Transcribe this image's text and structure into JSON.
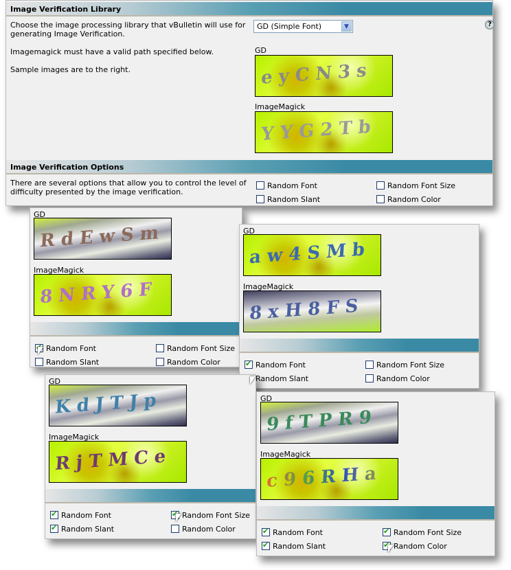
{
  "library": {
    "header": "Image Verification Library",
    "description_1": "Choose the image processing library that vBulletin will use for generating Image Verification.",
    "description_2": "Imagemagick must have a valid path specified below.",
    "description_3": "Sample images are to the right.",
    "select_value": "GD (Simple Font)",
    "help_icon": "help-question-icon",
    "gd_label": "GD",
    "imagemagick_label": "ImageMagick",
    "gd_sample": "eyCN3s",
    "imagemagick_sample": "YYG2Tb"
  },
  "options": {
    "header": "Image Verification Options",
    "description": "There are several options that allow you to control the level of difficulty presented by the image verification.",
    "labels": [
      "Random Font",
      "Random Font Size",
      "Random Slant",
      "Random Color"
    ]
  },
  "panels": [
    {
      "gd_label": "GD",
      "imagemagick_label": "ImageMagick",
      "gd_sample": "RdEwSm",
      "imagemagick_sample": "8NRY6F",
      "checked": [
        true,
        false,
        false,
        false
      ],
      "labels": [
        "Random Font",
        "Random Font Size",
        "Random Slant",
        "Random Color"
      ]
    },
    {
      "gd_label": "GD",
      "imagemagick_label": "ImageMagick",
      "gd_sample": "aw4SMb",
      "imagemagick_sample": "8xH8FS",
      "checked": [
        true,
        false,
        true,
        false
      ],
      "labels": [
        "Random Font",
        "Random Font Size",
        "Random Slant",
        "Random Color"
      ]
    },
    {
      "gd_label": "GD",
      "imagemagick_label": "ImageMagick",
      "gd_sample": "KdJTJp",
      "imagemagick_sample": "RjTMCe",
      "checked": [
        true,
        true,
        true,
        false
      ],
      "labels": [
        "Random Font",
        "Random Font Size",
        "Random Slant",
        "Random Color"
      ]
    },
    {
      "gd_label": "GD",
      "imagemagick_label": "ImageMagick",
      "gd_sample": "9fTPR9",
      "imagemagick_sample": "c96RHa",
      "checked": [
        true,
        true,
        true,
        true
      ],
      "labels": [
        "Random Font",
        "Random Font Size",
        "Random Slant",
        "Random Color"
      ]
    }
  ],
  "colors": {
    "header_teal": "#3a8aa5",
    "panel_bg": "#f0f0f0",
    "check_green": "#1a9a1a"
  }
}
